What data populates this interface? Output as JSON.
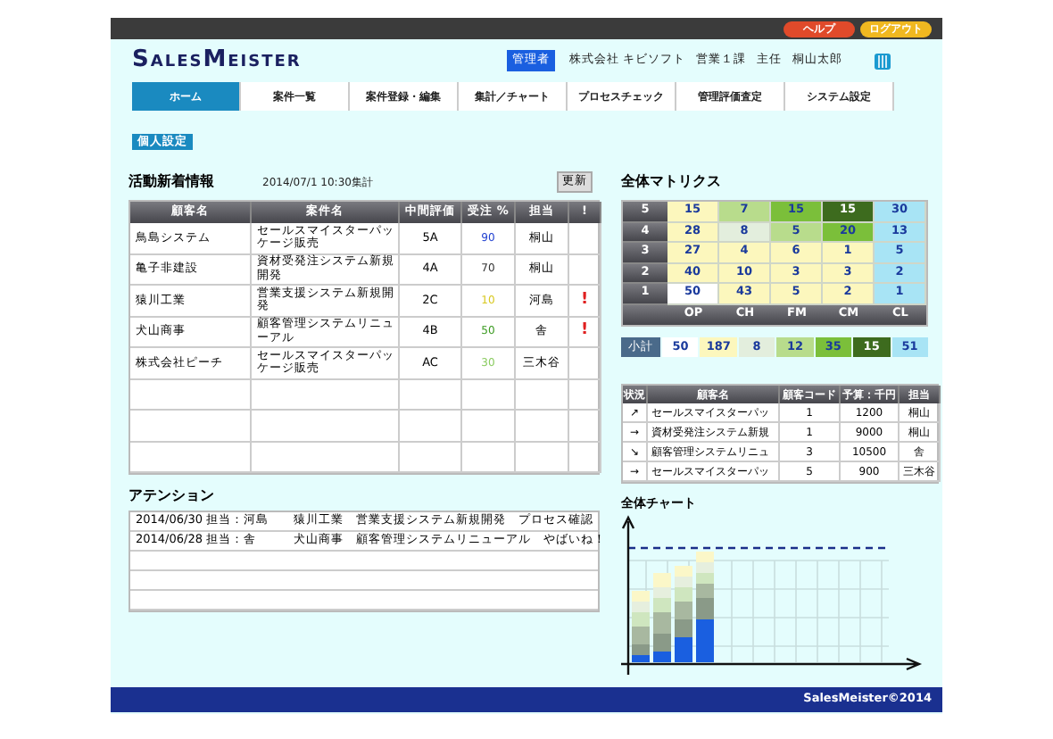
{
  "top_buttons": [
    {
      "label": "ヘルプ",
      "color": "#e04a2a"
    },
    {
      "label": "ログアウト",
      "color": "#f0b820"
    }
  ],
  "logo": "SalesMeister",
  "user": {
    "role": "管理者",
    "company": "株式会社 キビソフト",
    "department": "営業１課",
    "position": "主任",
    "name": "桐山太郎"
  },
  "nav": [
    {
      "label": "ホーム",
      "selected": true
    },
    {
      "label": "案件一覧",
      "selected": false
    },
    {
      "label": "案件登録・編集",
      "selected": false
    },
    {
      "label": "集計／チャート",
      "selected": false
    },
    {
      "label": "プロセスチェック",
      "selected": false
    },
    {
      "label": "管理評価査定",
      "selected": false
    },
    {
      "label": "システム設定",
      "selected": false
    }
  ],
  "sub_button": "個人設定",
  "activity": {
    "title": "活動新着情報",
    "timestamp": "2014/07/1  10:30集計",
    "refresh": "更新",
    "columns": [
      "顧客名",
      "案件名",
      "中間評価",
      "受注 %",
      "担当",
      "!"
    ],
    "rows": [
      {
        "customer": "鳥島システム",
        "project": "セールスマイスターパッケージ販売",
        "grade": "5A",
        "rate": "90",
        "color": "#2040d0",
        "owner": "桐山"
      },
      {
        "customer": "亀子非建設",
        "project": "資材受発注システム新規開発",
        "grade": "4A",
        "rate": "70",
        "color": "#333333",
        "owner": "桐山"
      },
      {
        "customer": "猿川工業",
        "project": "営業支援システム新規開発",
        "grade": "2C",
        "rate": "10",
        "color": "#d8c820",
        "owner": "河島",
        "alert": "!"
      },
      {
        "customer": "犬山商事",
        "project": "顧客管理システムリニューアル",
        "grade": "4B",
        "rate": "50",
        "color": "#3a9a20",
        "owner": "舎",
        "alert": "!"
      },
      {
        "customer": "株式会社ピーチ",
        "project": "セールスマイスターパッケージ販売",
        "grade": "AC",
        "rate": "30",
        "color": "#8acb60",
        "owner": "三木谷"
      }
    ]
  },
  "attention": {
    "title": "アテンション",
    "items": [
      "2014/06/30 担当：河島　　猿川工業　営業支援システム新規開発　プロセス確認",
      "2014/06/28 担当：舎　　　犬山商事　顧客管理システムリニューアル　やばいね！"
    ]
  },
  "matrix": {
    "title": "全体マトリクス",
    "rows": [
      {
        "label": "5",
        "cells": [
          {
            "value": "15",
            "color": "#fcf7bd"
          },
          {
            "value": "7",
            "color": "#b8dc8c"
          },
          {
            "value": "15",
            "color": "#7bbf3a"
          },
          {
            "value": "15",
            "color": "#3d6b1e"
          },
          {
            "value": "30",
            "color": "#a8e4f5"
          }
        ]
      },
      {
        "label": "4",
        "cells": [
          {
            "value": "28",
            "color": "#fcf7bd"
          },
          {
            "value": "8",
            "color": "#e3eedd"
          },
          {
            "value": "5",
            "color": "#b8dc8c"
          },
          {
            "value": "20",
            "color": "#7bbf3a"
          },
          {
            "value": "13",
            "color": "#a8e4f5"
          }
        ]
      },
      {
        "label": "3",
        "cells": [
          {
            "value": "27",
            "color": "#fcf7bd"
          },
          {
            "value": "4",
            "color": "#fcf7bd"
          },
          {
            "value": "6",
            "color": "#fcf7bd"
          },
          {
            "value": "1",
            "color": "#fcf7bd"
          },
          {
            "value": "5",
            "color": "#a8e4f5"
          }
        ]
      },
      {
        "label": "2",
        "cells": [
          {
            "value": "40",
            "color": "#fcf7bd"
          },
          {
            "value": "10",
            "color": "#fcf7bd"
          },
          {
            "value": "3",
            "color": "#fcf7bd"
          },
          {
            "value": "3",
            "color": "#fcf7bd"
          },
          {
            "value": "2",
            "color": "#a8e4f5"
          }
        ]
      },
      {
        "label": "1",
        "cells": [
          {
            "value": "50",
            "color": "#ffffff"
          },
          {
            "value": "43",
            "color": "#fcf7bd"
          },
          {
            "value": "5",
            "color": "#fcf7bd"
          },
          {
            "value": "2",
            "color": "#fcf7bd"
          },
          {
            "value": "1",
            "color": "#a8e4f5"
          }
        ]
      }
    ],
    "x_axis_labels": [
      "OP",
      "CH",
      "FM",
      "CM",
      "CL"
    ],
    "subtotal": {
      "label": "小計",
      "cells": [
        {
          "value": "50",
          "color": "#ffffff"
        },
        {
          "value": "187",
          "color": "#fcf7bd"
        },
        {
          "value": "8",
          "color": "#e3eedd"
        },
        {
          "value": "12",
          "color": "#b8dc8c"
        },
        {
          "value": "35",
          "color": "#7bbf3a"
        },
        {
          "value": "15",
          "color": "#3d6b1e"
        },
        {
          "value": "51",
          "color": "#a8e4f5"
        }
      ]
    }
  },
  "status_table": {
    "columns": [
      "状況",
      "顧客名",
      "顧客コード",
      "予算：千円",
      "担当"
    ],
    "rows": [
      {
        "status": "↗",
        "customer": "セールスマイスターパッ",
        "code": "1",
        "budget": "1200",
        "owner": "桐山"
      },
      {
        "status": "→",
        "customer": "資材受発注システム新規",
        "code": "1",
        "budget": "9000",
        "owner": "桐山"
      },
      {
        "status": "↘",
        "customer": "顧客管理システムリニュ",
        "code": "3",
        "budget": "10500",
        "owner": "舎"
      },
      {
        "status": "→",
        "customer": "セールスマイスターパッ",
        "code": "5",
        "budget": "900",
        "owner": "三木谷"
      }
    ]
  },
  "chart": {
    "title": "全体チャート"
  },
  "footer": "SalesMeister©2014"
}
